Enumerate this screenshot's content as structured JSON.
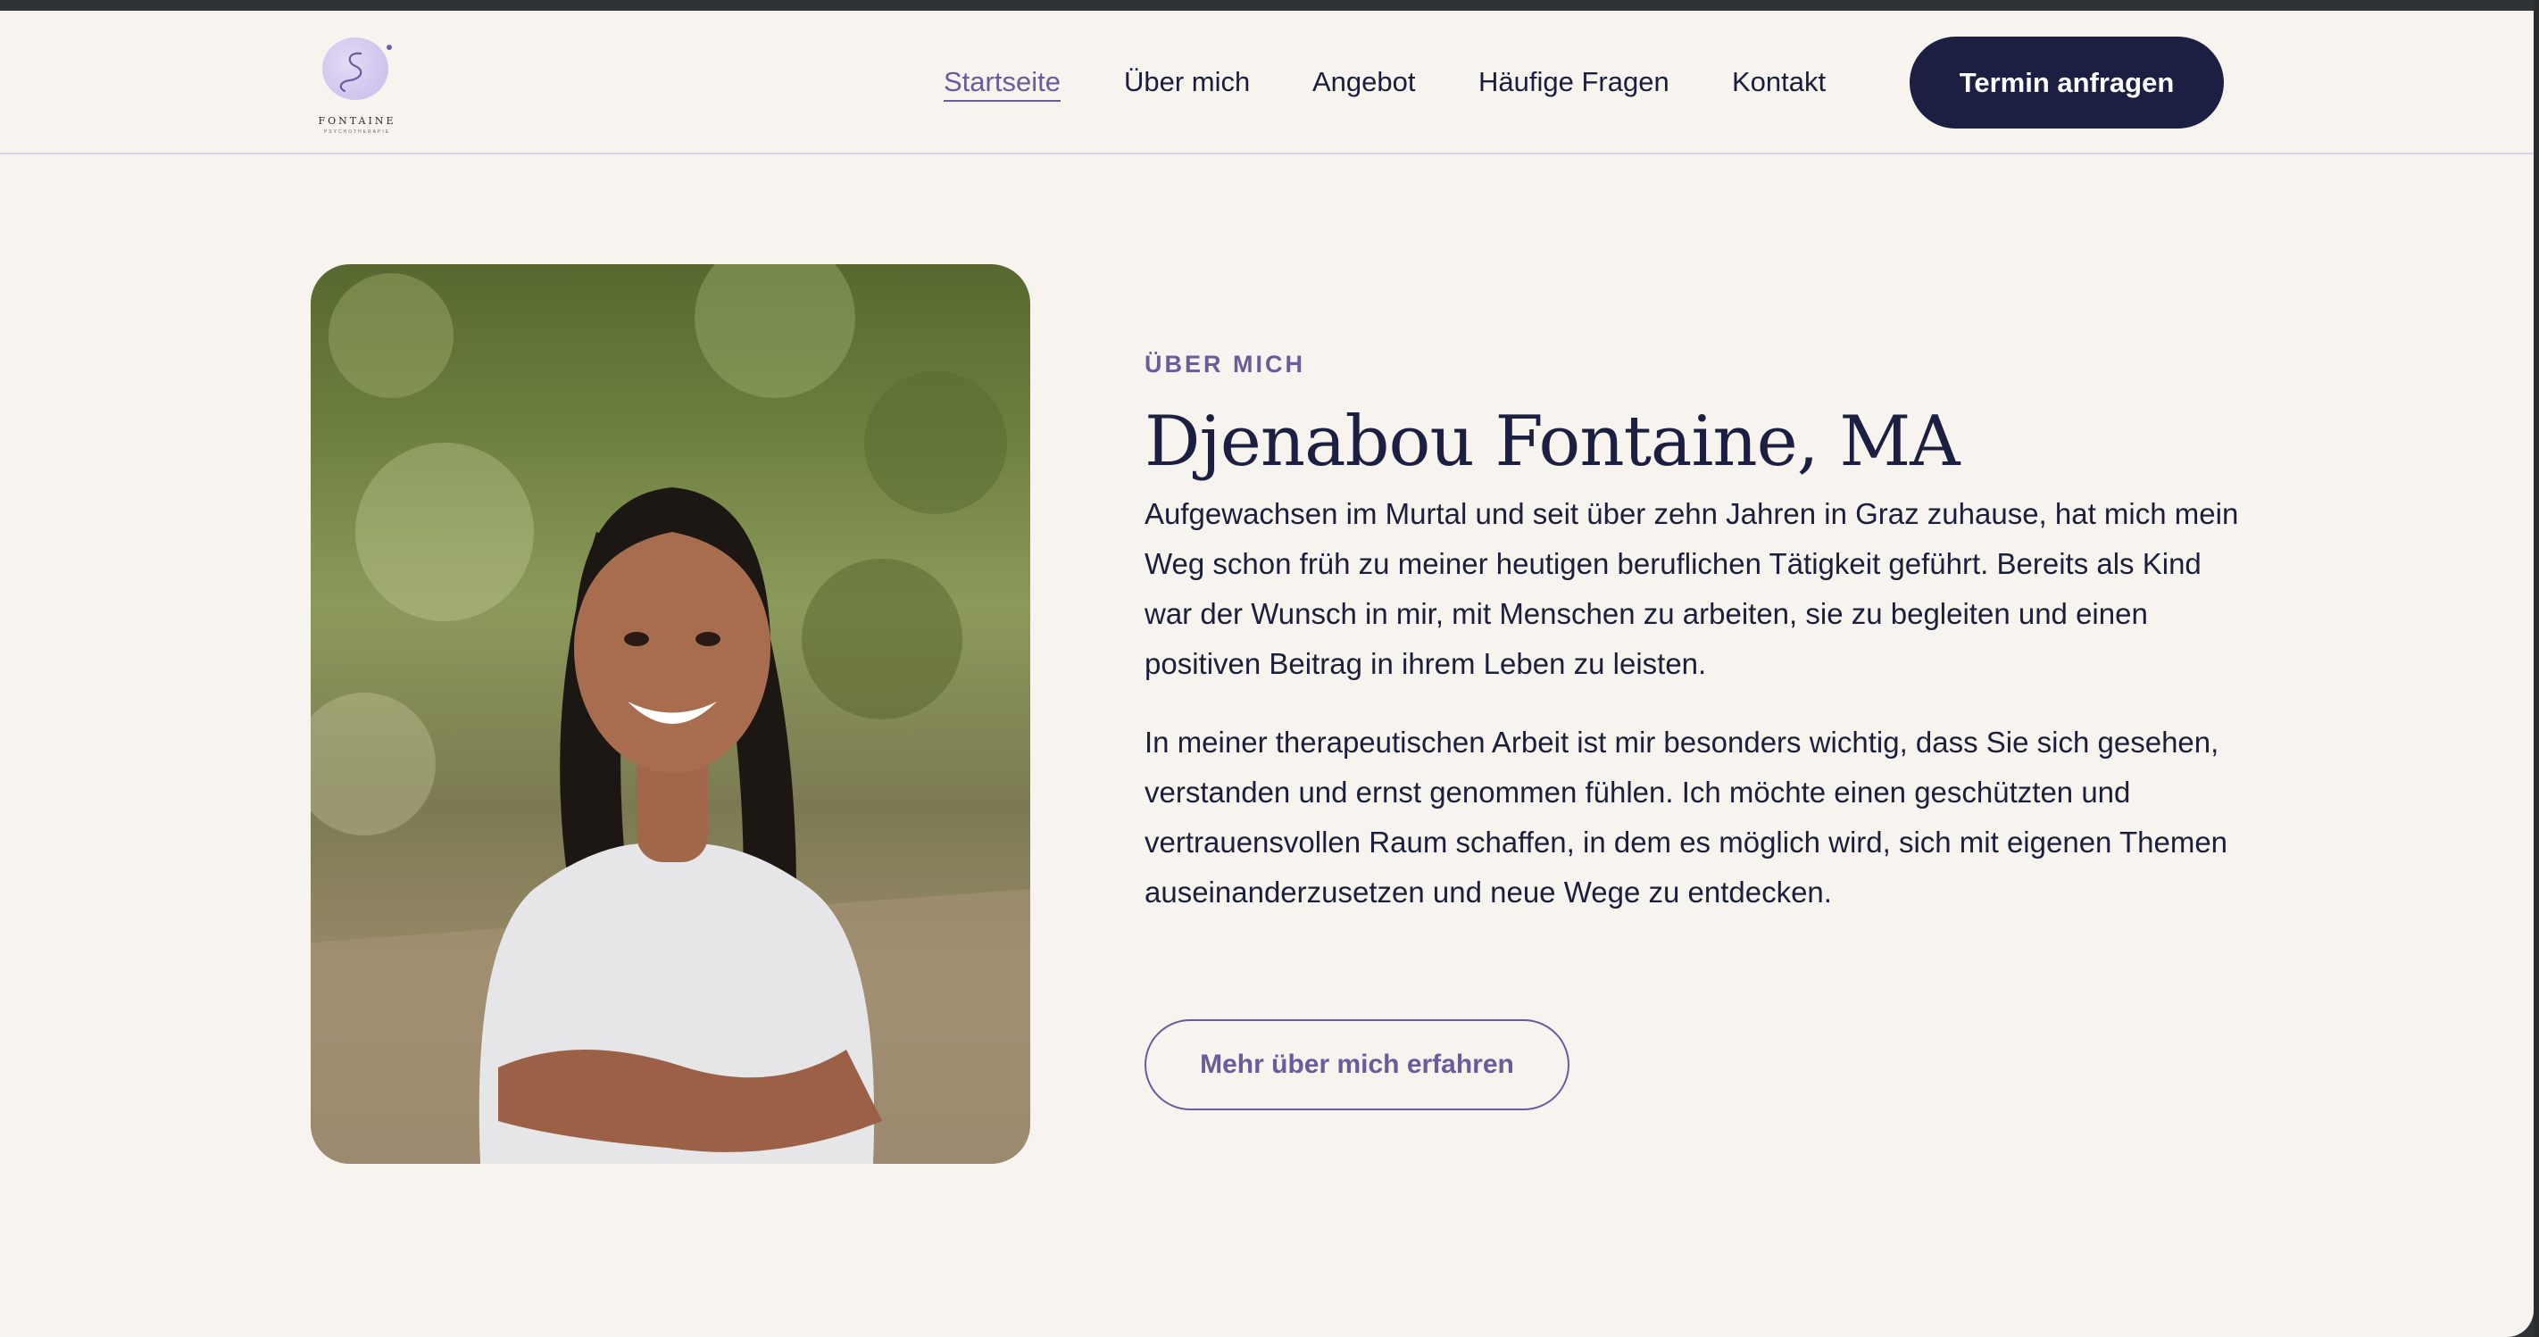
{
  "brand": {
    "name": "FONTAINE",
    "tagline": "PSYCHOTHERAPIE"
  },
  "nav": {
    "items": [
      {
        "label": "Startseite",
        "active": true
      },
      {
        "label": "Über mich",
        "active": false
      },
      {
        "label": "Angebot",
        "active": false
      },
      {
        "label": "Häufige Fragen",
        "active": false
      },
      {
        "label": "Kontakt",
        "active": false
      }
    ],
    "cta_label": "Termin anfragen"
  },
  "about": {
    "eyebrow": "ÜBER MICH",
    "title": "Djenabou Fontaine, MA",
    "paragraph_1": "Aufgewachsen im Murtal und seit über zehn Jahren in Graz zuhause, hat mich mein Weg schon früh zu meiner heutigen beruflichen Tätigkeit geführt. Bereits als Kind war der Wunsch in mir, mit Menschen zu arbeiten, sie zu begleiten und einen positiven Beitrag in ihrem Leben zu leisten.",
    "paragraph_2": "In meiner therapeutischen Arbeit ist mir besonders wichtig, dass Sie sich gesehen, verstanden und ernst genommen fühlen. Ich möchte einen geschützten und vertrauensvollen Raum schaffen, in dem es möglich wird, sich mit eigenen Themen auseinanderzusetzen und neue Wege zu entdecken.",
    "more_label": "Mehr über mich erfahren"
  },
  "colors": {
    "accent": "#6b5a9c",
    "navy": "#1c1e42",
    "background": "#f7f4ef"
  }
}
